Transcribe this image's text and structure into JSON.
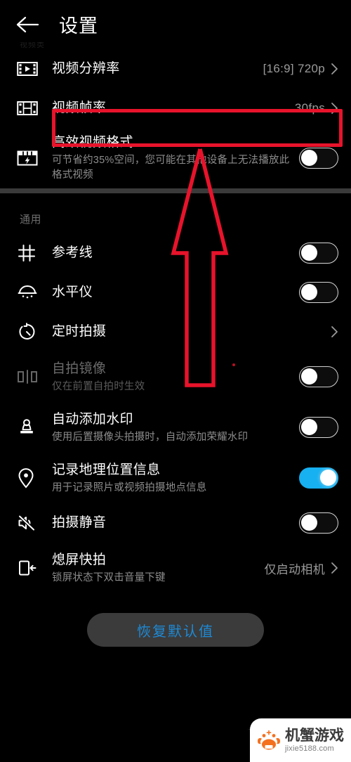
{
  "header": {
    "title": "设置",
    "back_icon": "arrow-left-icon",
    "faint_section_label": "视频类"
  },
  "video_section": {
    "rows": [
      {
        "icon": "video-resolution-icon",
        "title": "视频分辨率",
        "value": "[16:9] 720p",
        "control": "chevron",
        "highlighted": false
      },
      {
        "icon": "film-strip-icon",
        "title": "视频帧率",
        "value": "30fps",
        "control": "chevron",
        "highlighted": true
      },
      {
        "icon": "efficient-video-icon",
        "title": "高效视频格式",
        "sub": "可节省约35%空间，您可能在其他设备上无法播放此格式视频",
        "control": "toggle",
        "toggle_on": false
      }
    ]
  },
  "general_section": {
    "header": "通用",
    "rows": [
      {
        "icon": "grid-lines-icon",
        "title": "参考线",
        "control": "toggle",
        "toggle_on": false,
        "disabled": false
      },
      {
        "icon": "level-meter-icon",
        "title": "水平仪",
        "control": "toggle",
        "toggle_on": false,
        "disabled": false
      },
      {
        "icon": "timer-icon",
        "title": "定时拍摄",
        "control": "chevron",
        "value": "",
        "disabled": false
      },
      {
        "icon": "mirror-selfie-icon",
        "title": "自拍镜像",
        "sub": "仅在前置自拍时生效",
        "control": "toggle",
        "toggle_on": false,
        "disabled": true
      },
      {
        "icon": "watermark-stamp-icon",
        "title": "自动添加水印",
        "sub": "使用后置摄像头拍摄时，自动添加荣耀水印",
        "control": "toggle",
        "toggle_on": false,
        "disabled": false
      },
      {
        "icon": "location-pin-icon",
        "title": "记录地理位置信息",
        "sub": "用于记录照片或视频拍摄地点信息",
        "control": "toggle",
        "toggle_on": true,
        "disabled": false
      },
      {
        "icon": "mute-speaker-icon",
        "title": "拍摄静音",
        "control": "toggle",
        "toggle_on": false,
        "disabled": false
      },
      {
        "icon": "screen-off-capture-icon",
        "title": "熄屏快拍",
        "sub": "锁屏状态下双击音量下键",
        "control": "chevron",
        "value": "仅启动相机",
        "disabled": false
      }
    ]
  },
  "footer": {
    "reset_label": "恢复默认值"
  },
  "annotation": {
    "arrow": "up-arrow-annotation",
    "highlight_box": "red-highlight-box",
    "color": "#e8132b"
  },
  "watermark": {
    "name": "机蟹游戏",
    "url": "jixie5188.com",
    "logo_icon": "crab-logo-icon",
    "brand_color": "#f4701f"
  },
  "colors": {
    "background": "#000000",
    "accent_blue": "#17b0f0",
    "button_blue": "#1d8ad6",
    "divider": "#3a3a3a",
    "subtitle": "#8c8c8c"
  }
}
